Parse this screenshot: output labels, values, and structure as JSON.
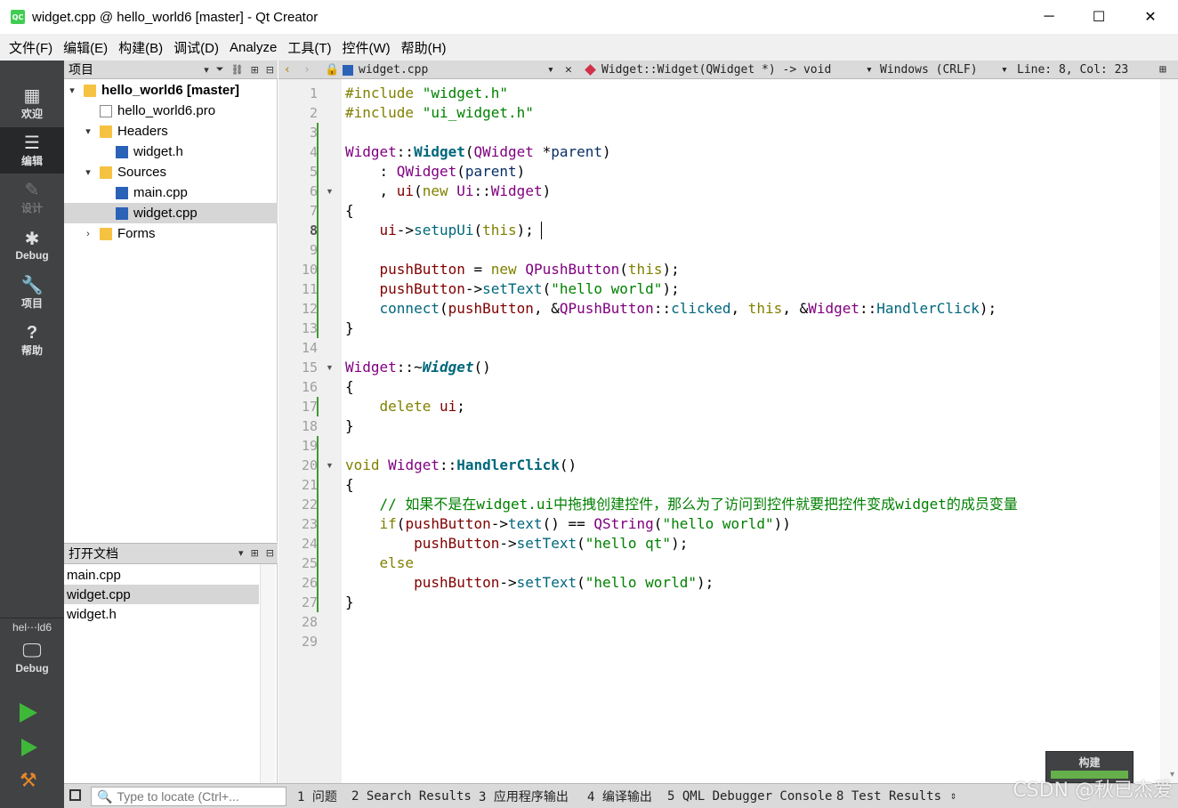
{
  "window": {
    "title": "widget.cpp @ hello_world6 [master] - Qt Creator",
    "app_icon_label": "QC"
  },
  "menubar": [
    "文件(F)",
    "编辑(E)",
    "构建(B)",
    "调试(D)",
    "Analyze",
    "工具(T)",
    "控件(W)",
    "帮助(H)"
  ],
  "modes": [
    {
      "label": "欢迎",
      "icon": "grid-icon",
      "glyph": "▦",
      "state": "normal"
    },
    {
      "label": "编辑",
      "icon": "edit-icon",
      "glyph": "☰",
      "state": "active"
    },
    {
      "label": "设计",
      "icon": "pencil-icon",
      "glyph": "✎",
      "state": "disabled"
    },
    {
      "label": "Debug",
      "icon": "bug-icon",
      "glyph": "✱",
      "state": "normal"
    },
    {
      "label": "项目",
      "icon": "wrench-icon",
      "glyph": "🔧",
      "state": "normal"
    },
    {
      "label": "帮助",
      "icon": "help-icon",
      "glyph": "?",
      "state": "normal"
    }
  ],
  "kit_selector": {
    "project": "hel⋯ld6",
    "config": "Debug"
  },
  "sidebar": {
    "title": "项目",
    "tree": [
      {
        "label": "hello_world6 [master]",
        "level": 0,
        "arrow": "▾",
        "icon": "folder",
        "bold": true
      },
      {
        "label": "hello_world6.pro",
        "level": 1,
        "arrow": "",
        "icon": "pro"
      },
      {
        "label": "Headers",
        "level": 1,
        "arrow": "▾",
        "icon": "folder"
      },
      {
        "label": "widget.h",
        "level": 2,
        "arrow": "",
        "icon": "cpp"
      },
      {
        "label": "Sources",
        "level": 1,
        "arrow": "▾",
        "icon": "folder"
      },
      {
        "label": "main.cpp",
        "level": 2,
        "arrow": "",
        "icon": "cpp"
      },
      {
        "label": "widget.cpp",
        "level": 2,
        "arrow": "",
        "icon": "cpp",
        "selected": true
      },
      {
        "label": "Forms",
        "level": 1,
        "arrow": "›",
        "icon": "folder"
      }
    ]
  },
  "open_documents": {
    "title": "打开文档",
    "items": [
      {
        "label": "main.cpp"
      },
      {
        "label": "widget.cpp",
        "selected": true
      },
      {
        "label": "widget.h"
      }
    ]
  },
  "editor_toolbar": {
    "file": "widget.cpp",
    "symbol": "Widget::Widget(QWidget *) -> void",
    "line_endings": "Windows (CRLF)",
    "position": "Line: 8, Col: 23"
  },
  "code": {
    "current_line": 8,
    "line_numbers": [
      1,
      2,
      3,
      4,
      5,
      6,
      7,
      8,
      9,
      10,
      11,
      12,
      13,
      14,
      15,
      16,
      17,
      18,
      19,
      20,
      21,
      22,
      23,
      24,
      25,
      26,
      27,
      28,
      29
    ]
  },
  "build_widget": {
    "label": "构建"
  },
  "locator": {
    "placeholder": "Type to locate (Ctrl+..."
  },
  "output_tabs": [
    "1 问题",
    "2 Search Results",
    "3 应用程序输出",
    "4 编译输出",
    "5 QML Debugger Console",
    "8 Test Results"
  ],
  "watermark": "CSDN @秋已杰爱"
}
